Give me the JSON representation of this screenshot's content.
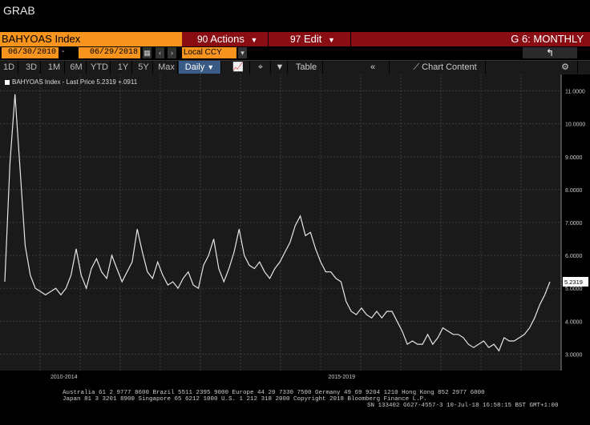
{
  "window": {
    "title": "GRAB"
  },
  "command_bar": {
    "ticker": "BAHYOAS Index",
    "actions_num": "90",
    "actions_label": "Actions",
    "edit_num": "97",
    "edit_label": "Edit",
    "graph_title": "G 6: MONTHLY",
    "accent_color": "#8b0d14",
    "ticker_bg": "#f7941d"
  },
  "range": {
    "start_date": "06/30/2010",
    "end_date": "06/29/2018",
    "currency": "Local CCY"
  },
  "periods": [
    "1D",
    "3D",
    "1M",
    "6M",
    "YTD",
    "1Y",
    "5Y",
    "Max",
    "Daily"
  ],
  "toolbar": {
    "table_label": "Table",
    "chart_content_label": "Chart Content"
  },
  "chart_data": {
    "type": "line",
    "legend": "BAHYOAS Index - Last Price 5.2319  +.0911",
    "last_value_label": "5.2319",
    "x_ticks": [
      "2010-2014",
      "2015-2019"
    ],
    "y_ticks": [
      "11.0000",
      "10.0000",
      "9.0000",
      "8.0000",
      "7.0000",
      "6.0000",
      "5.0000",
      "4.0000",
      "3.0000"
    ],
    "ylim": [
      2.5,
      11.5
    ],
    "series": [
      {
        "values": [
          5.2,
          8.8,
          10.9,
          8.6,
          6.3,
          5.4,
          5.0,
          4.9,
          4.8,
          4.9,
          5.0,
          4.8,
          5.0,
          5.4,
          6.2,
          5.4,
          5.0,
          5.6,
          5.9,
          5.5,
          5.3,
          6.0,
          5.6,
          5.2,
          5.5,
          5.8,
          6.8,
          6.1,
          5.5,
          5.3,
          5.8,
          5.4,
          5.1,
          5.2,
          5.0,
          5.3,
          5.5,
          5.1,
          5.0,
          5.7,
          6.0,
          6.5,
          5.6,
          5.2,
          5.6,
          6.1,
          6.8,
          6.0,
          5.7,
          5.6,
          5.8,
          5.5,
          5.3,
          5.6,
          5.8,
          6.1,
          6.4,
          6.9,
          7.2,
          6.6,
          6.7,
          6.2,
          5.8,
          5.5,
          5.5,
          5.3,
          5.2,
          4.6,
          4.3,
          4.2,
          4.4,
          4.2,
          4.1,
          4.3,
          4.1,
          4.3,
          4.3,
          4.0,
          3.7,
          3.3,
          3.4,
          3.3,
          3.3,
          3.6,
          3.3,
          3.5,
          3.8,
          3.7,
          3.6,
          3.6,
          3.5,
          3.3,
          3.2,
          3.3,
          3.4,
          3.2,
          3.3,
          3.1,
          3.5,
          3.4,
          3.4,
          3.5,
          3.6,
          3.8,
          4.1,
          4.5,
          4.8,
          5.2
        ]
      }
    ],
    "grid": true,
    "line_color": "#e6e6e6",
    "background": "#1a1a1a"
  },
  "footer": {
    "line1": "Australia 61 2 9777 8600 Brazil 5511 2395 9000 Europe 44 20 7330 7500 Germany 49 69 9204 1210 Hong Kong 852 2977 6000",
    "line2": "Japan 81 3 3201 8900         Singapore 65 6212 1000      U.S. 1 212 318 2000           Copyright 2018 Bloomberg Finance L.P.",
    "line3": "SN 133402 G627-4557-3 10-Jul-18 16:58:15 BST  GMT+1:00"
  }
}
